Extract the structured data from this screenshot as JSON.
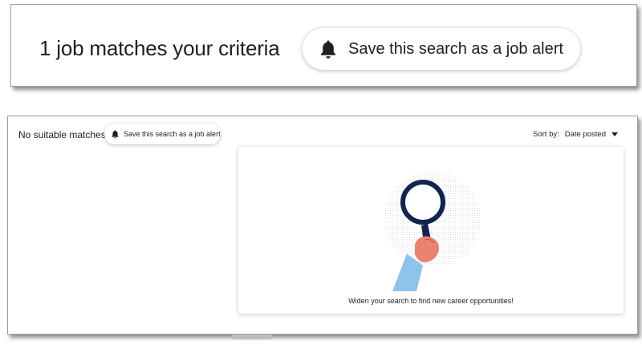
{
  "top": {
    "match_count": "1 job matches your criteria",
    "alert_button_label": "Save this search as a job alert"
  },
  "bottom": {
    "no_match_text": "No suitable matches",
    "alert_button_label": "Save this search as a job alert",
    "sort_label": "Sort by:",
    "sort_value": "Date posted",
    "empty_message": "Widen your search to find new career opportunities!"
  },
  "icons": {
    "alert": "bell-icon",
    "sort": "caret-down-icon",
    "illustration": "magnifying-glass-hand-illustration"
  },
  "colors": {
    "lens_ring": "#13254e",
    "handle": "#13254e",
    "skin": "#e8836f",
    "sleeve": "#8fc3ea",
    "text": "#1f1f1f"
  }
}
